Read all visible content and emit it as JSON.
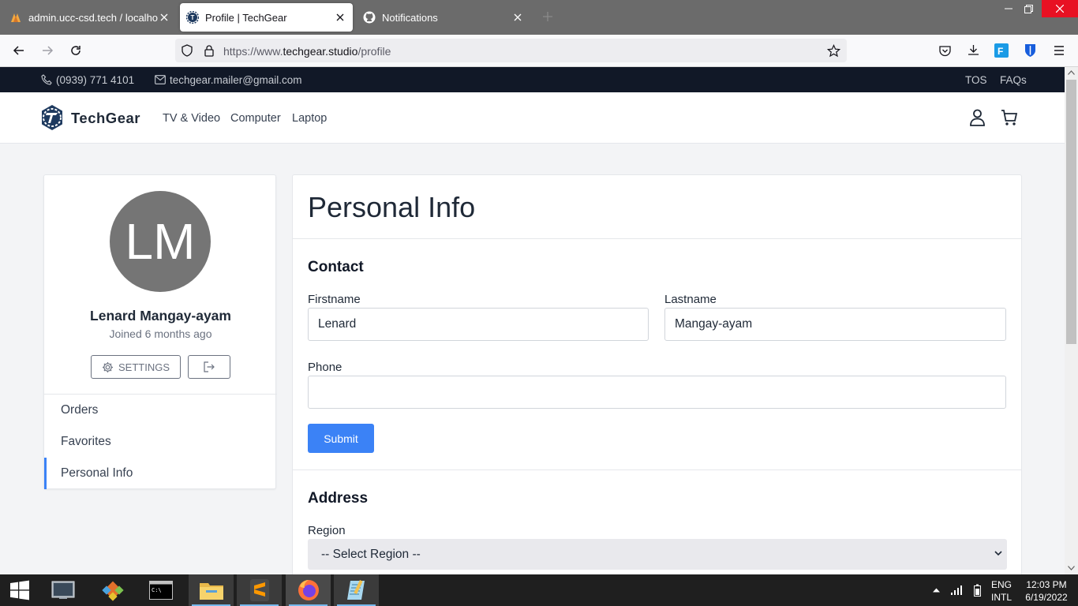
{
  "browser": {
    "tabs": [
      {
        "label": "admin.ucc-csd.tech / localhost",
        "icon": "admin-favicon-icon"
      },
      {
        "label": "Profile | TechGear",
        "icon": "techgear-favicon-icon"
      },
      {
        "label": "Notifications",
        "icon": "github-icon"
      }
    ],
    "url_prefix": "https://www.",
    "url_domain": "techgear.studio",
    "url_path": "/profile"
  },
  "site": {
    "phone": "(0939) 771 4101",
    "email": "techgear.mailer@gmail.com",
    "top_links": [
      "TOS",
      "FAQs"
    ],
    "brand": "TechGear",
    "nav": [
      "TV & Video",
      "Computer",
      "Laptop"
    ]
  },
  "profile": {
    "initials": "LM",
    "name": "Lenard Mangay-ayam",
    "joined": "Joined 6 months ago",
    "settings_label": "SETTINGS",
    "menu": [
      "Orders",
      "Favorites",
      "Personal Info"
    ],
    "active_menu": "Personal Info"
  },
  "form": {
    "title": "Personal Info",
    "contact_heading": "Contact",
    "firstname_label": "Firstname",
    "firstname_value": "Lenard",
    "lastname_label": "Lastname",
    "lastname_value": "Mangay-ayam",
    "phone_label": "Phone",
    "phone_value": "",
    "submit_label": "Submit",
    "address_heading": "Address",
    "region_label": "Region",
    "region_selected": "-- Select Region --"
  },
  "taskbar": {
    "lang": "ENG",
    "layout": "INTL",
    "time": "12:03 PM",
    "date": "6/19/2022"
  },
  "colors": {
    "primary": "#3b82f6",
    "topbar": "#111827",
    "avatar": "#757575"
  }
}
